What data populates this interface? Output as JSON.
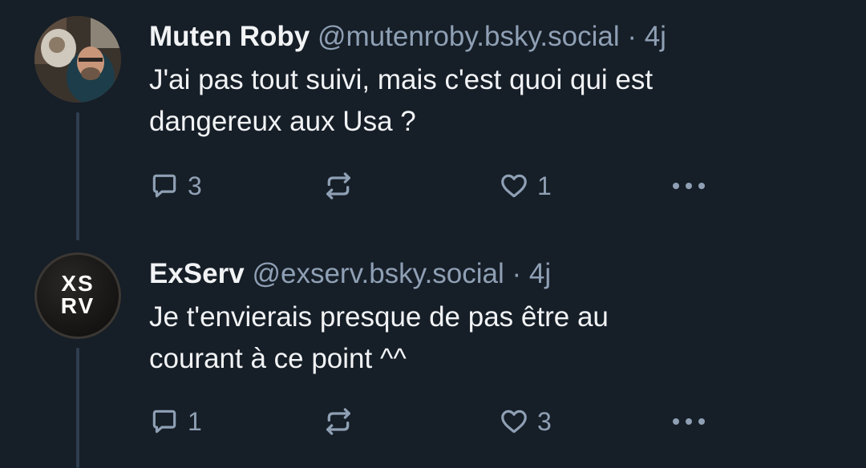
{
  "posts": [
    {
      "display_name": "Muten Roby",
      "handle": "@mutenroby.bsky.social",
      "separator": "·",
      "time": "4j",
      "text_lines": [
        "J'ai pas tout suivi, mais c'est quoi qui est",
        "dangereux aux Usa ?"
      ],
      "reply_count": "3",
      "like_count": "1",
      "avatar_icon": "user-photo-avatar"
    },
    {
      "display_name": "ExServ",
      "handle": "@exserv.bsky.social",
      "separator": "·",
      "time": "4j",
      "text_lines": [
        "Je t'envierais presque de pas être au",
        "courant à ce point ^^"
      ],
      "reply_count": "1",
      "like_count": "3",
      "avatar_logo_lines": [
        "XS",
        "RV"
      ]
    }
  ],
  "icons": {
    "reply": "reply-icon",
    "repost": "repost-icon",
    "like": "heart-icon",
    "more": "more-icon"
  },
  "colors": {
    "background": "#161e27",
    "text": "#f1f3f5",
    "muted": "#8fa0b5",
    "thread_line": "#2e3d4f"
  }
}
